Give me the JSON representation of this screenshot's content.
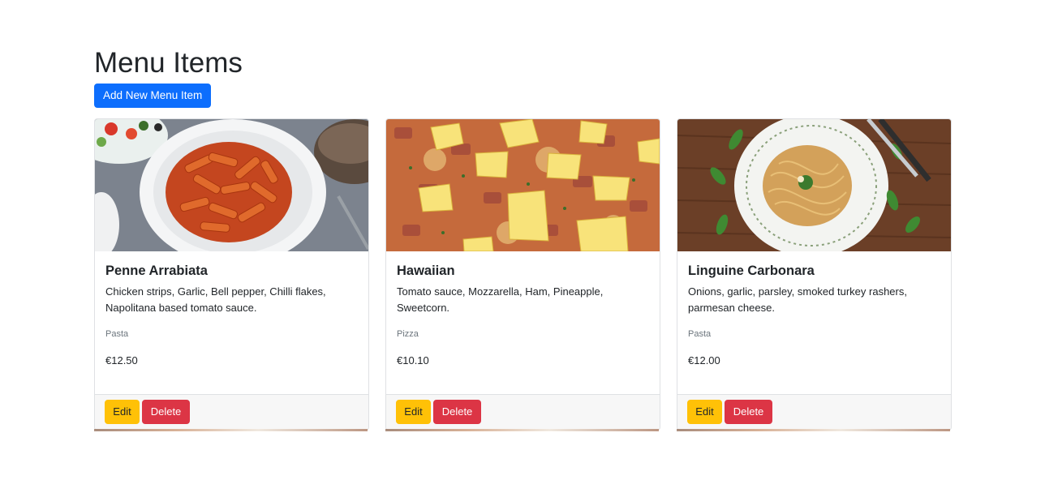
{
  "page": {
    "title": "Menu Items",
    "add_button_label": "Add New Menu Item"
  },
  "items": [
    {
      "name": "Penne Arrabiata",
      "description": "Chicken strips, Garlic, Bell pepper, Chilli flakes, Napolitana based tomato sauce.",
      "category": "Pasta",
      "price": "€12.50",
      "image": "penne-pasta-photo",
      "edit_label": "Edit",
      "delete_label": "Delete"
    },
    {
      "name": "Hawaiian",
      "description": "Tomato sauce, Mozzarella, Ham, Pineapple, Sweetcorn.",
      "category": "Pizza",
      "price": "€10.10",
      "image": "hawaiian-pizza-photo",
      "edit_label": "Edit",
      "delete_label": "Delete"
    },
    {
      "name": "Linguine Carbonara",
      "description": "Onions, garlic, parsley, smoked turkey rashers, parmesan cheese.",
      "category": "Pasta",
      "price": "€12.00",
      "image": "linguine-carbonara-photo",
      "edit_label": "Edit",
      "delete_label": "Delete"
    }
  ],
  "colors": {
    "primary": "#0d6efd",
    "warning": "#ffc107",
    "danger": "#dc3545",
    "muted": "#6c757d"
  }
}
